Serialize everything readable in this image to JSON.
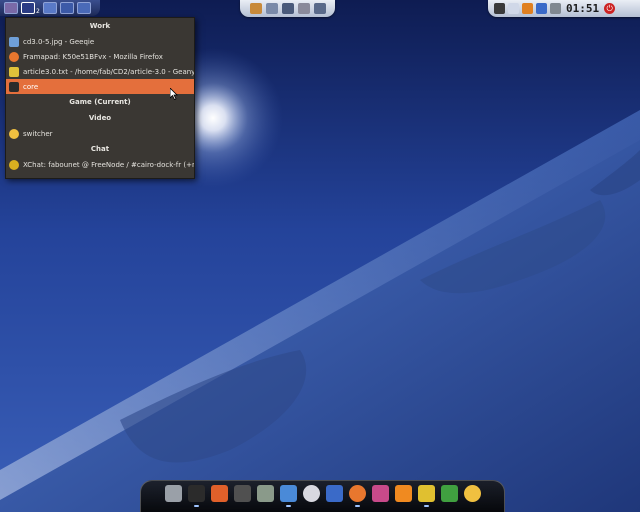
{
  "top_bar": {
    "desktops": [
      {
        "icon": "desktop-thumbnail-icon",
        "color": "#7a6aa8"
      },
      {
        "icon": "desktop-thumbnail-icon",
        "color": "#2b3c85",
        "badge": "2"
      },
      {
        "icon": "desktop-thumbnail-icon",
        "color": "#5a7ac8"
      },
      {
        "icon": "desktop-thumbnail-icon",
        "color": "#3c5aa8"
      },
      {
        "icon": "desktop-thumbnail-icon",
        "color": "#4a6ab8"
      }
    ],
    "launchers": [
      "home-folder-icon",
      "window-icon",
      "edit-icon",
      "notes-icon",
      "display-icon"
    ],
    "systray": {
      "icons": [
        "ftp-icon",
        "mail-icon",
        "weather-icon",
        "network-icon",
        "sound-icon"
      ],
      "clock": "01:51",
      "power_icon": "power-icon"
    }
  },
  "window_menu": {
    "groups": [
      {
        "title": "Work",
        "items": [
          {
            "label": "cd3.0-5.jpg - Geeqie",
            "icon": "geeqie-icon",
            "color": "#6f9fd8",
            "hover": false
          },
          {
            "label": "Framapad: K50e51BFvx - Mozilla Firefox",
            "icon": "firefox-icon",
            "color": "#e8772e",
            "hover": false
          },
          {
            "label": "article3.0.txt - /home/fab/CD2/article-3.0 - Geany",
            "icon": "geany-icon",
            "color": "#e0c23a",
            "hover": false
          },
          {
            "label": "core",
            "icon": "terminal-icon",
            "color": "#2b2b2b",
            "hover": true
          }
        ]
      },
      {
        "title": "Game (Current)",
        "items": []
      },
      {
        "title": "Video",
        "items": [
          {
            "label": "switcher",
            "icon": "switcher-icon",
            "color": "#f0c040",
            "hover": false
          }
        ]
      },
      {
        "title": "Chat",
        "items": [
          {
            "label": "XChat: fabounet @ FreeNode / #cairo-dock-fr (+nt)",
            "icon": "xchat-icon",
            "color": "#d8b020",
            "hover": false
          }
        ]
      }
    ],
    "accent": "#e46f3c",
    "background": "#3a3733"
  },
  "dock": {
    "icons": [
      {
        "name": "trash-icon",
        "color": "#9aa0a8",
        "running": false
      },
      {
        "name": "terminal-icon",
        "color": "#2b2b2b",
        "running": true
      },
      {
        "name": "software-center-icon",
        "color": "#e0602a",
        "running": false
      },
      {
        "name": "network-icon",
        "color": "#505050",
        "running": false
      },
      {
        "name": "calculator-icon",
        "color": "#8a9a8a",
        "running": false
      },
      {
        "name": "image-viewer-icon",
        "color": "#4a8ad8",
        "running": true
      },
      {
        "name": "cd-icon",
        "color": "#d8d8e0",
        "running": false
      },
      {
        "name": "mail-icon",
        "color": "#3a6ac8",
        "running": false
      },
      {
        "name": "firefox-icon",
        "color": "#e8772e",
        "running": true
      },
      {
        "name": "rss-icon",
        "color": "#c84a8a",
        "running": false
      },
      {
        "name": "tools-icon",
        "color": "#f08a20",
        "running": false
      },
      {
        "name": "chat-icon",
        "color": "#e0c030",
        "running": true
      },
      {
        "name": "appearance-icon",
        "color": "#40a040",
        "running": false
      },
      {
        "name": "switcher-icon",
        "color": "#f0c040",
        "running": false
      }
    ]
  }
}
